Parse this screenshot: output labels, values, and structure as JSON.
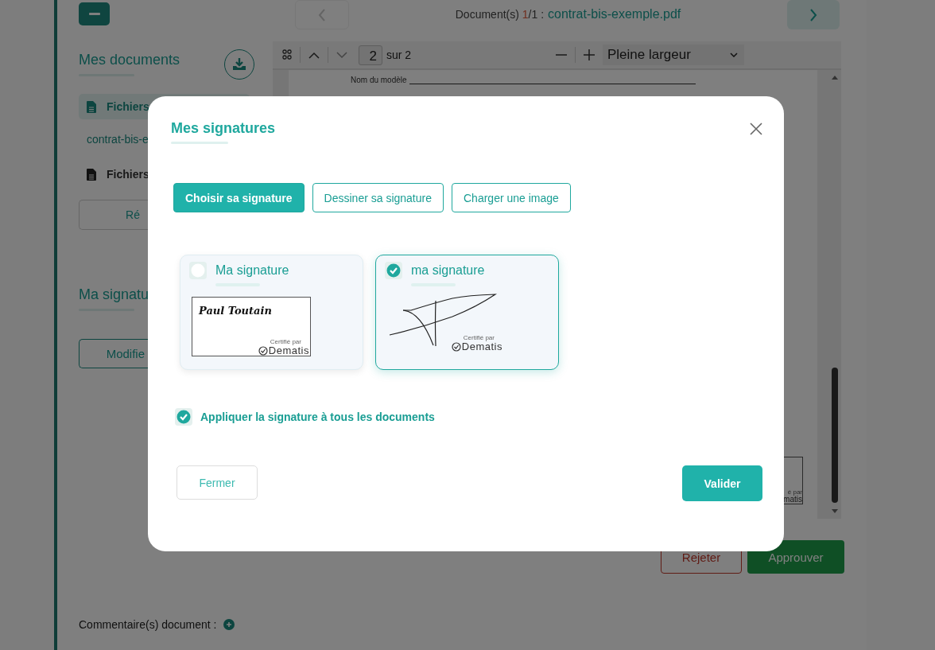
{
  "navigation": {
    "label": "Document(s)",
    "index": "1",
    "count": "/1 :",
    "file": "contrat-bis-exemple.pdf"
  },
  "sidebar": {
    "title": "Mes documents",
    "groups": [
      {
        "label": "Fichiers",
        "selected": true,
        "files": [
          "contrat-bis-e"
        ]
      },
      {
        "label": "Fichiers",
        "selected": false
      }
    ],
    "button": "Ré",
    "signature_title": "Ma signatu",
    "signature_button": "Modifie"
  },
  "viewer": {
    "page": "2",
    "page_total": "sur 2",
    "zoom": "Pleine largeur",
    "lines": [
      "Nom du modèle"
    ],
    "stamp": [
      "é par",
      "matis"
    ]
  },
  "actions": [
    {
      "label": "Rejeter",
      "kind": "reject"
    },
    {
      "label": "Approuver",
      "kind": "approve"
    }
  ],
  "comments": {
    "label": "Commentaire(s) document :"
  },
  "modal": {
    "title": "Mes signatures",
    "tabs": [
      {
        "label": "Choisir sa signature",
        "selected": true
      },
      {
        "label": "Dessiner sa signature",
        "selected": false
      },
      {
        "label": "Charger une image",
        "selected": false
      }
    ],
    "signatures": [
      {
        "title": "Ma signature",
        "selected": false,
        "kind": "typed",
        "text": "Paul Toutain",
        "certified": "Certifié par",
        "brand": "Dematis"
      },
      {
        "title": "ma signature",
        "selected": true,
        "kind": "drawn",
        "certified": "Certifié par",
        "brand": "Dematis"
      }
    ],
    "apply_all": {
      "label": "Appliquer la signature à tous les documents",
      "checked": true
    },
    "buttons": [
      {
        "label": "Fermer",
        "kind": "secondary"
      },
      {
        "label": "Valider",
        "kind": "primary"
      }
    ]
  }
}
